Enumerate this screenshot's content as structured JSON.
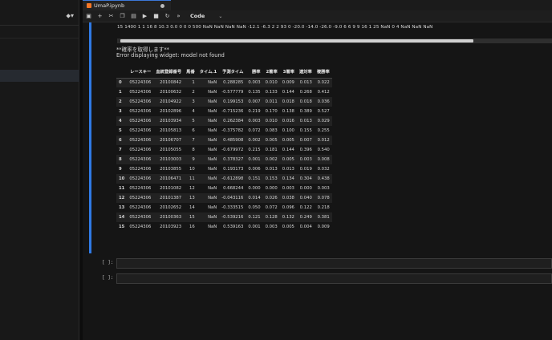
{
  "editor": {
    "tab": {
      "title": "UmaP.ipynb",
      "icon": "notebook-icon"
    },
    "toolbar": {
      "buttons": [
        "save-icon",
        "add-icon",
        "cut-icon",
        "copy-icon",
        "paste-icon",
        "run-icon",
        "stop-icon",
        "restart-icon",
        "fast-forward-icon"
      ],
      "glyphs": [
        "▣",
        "+",
        "✂",
        "❐",
        "▤",
        "▶",
        "■",
        "↻",
        "»"
      ],
      "cell_type": "Code",
      "chevron": "⌄"
    }
  },
  "sidepanel": {
    "tag_glyph": "⬥▾"
  },
  "output": {
    "topline": "15  1400   1   1   16   8   10.3   0.0   0   0   0   500   NaN   NaN   NaN   NaN   -12.1   -6.3   2   2   93   0   -20.0   -14.0   -26.0   -9.0   6   6   9   9   16   1   25   NaN   0   4   NaN   NaN   NaN",
    "message1": "**確率を取得します**",
    "message2": "Error displaying widget: model not found",
    "table": {
      "columns": [
        "",
        "レースキー",
        "血統登録番号",
        "馬番",
        "タイム.1",
        "予測タイム",
        "勝率",
        "2着率",
        "3着率",
        "連対率",
        "複勝率"
      ],
      "rows": [
        [
          "0",
          "05224306",
          "20100842",
          "1",
          "NaN",
          "0.288285",
          "0.003",
          "0.010",
          "0.009",
          "0.013",
          "0.022"
        ],
        [
          "1",
          "05224306",
          "20100632",
          "2",
          "NaN",
          "-0.577779",
          "0.135",
          "0.133",
          "0.144",
          "0.268",
          "0.412"
        ],
        [
          "2",
          "05224306",
          "20104922",
          "3",
          "NaN",
          "0.199153",
          "0.007",
          "0.011",
          "0.018",
          "0.018",
          "0.036"
        ],
        [
          "3",
          "05224306",
          "20102896",
          "4",
          "NaN",
          "-0.715236",
          "0.219",
          "0.170",
          "0.138",
          "0.389",
          "0.527"
        ],
        [
          "4",
          "05224306",
          "20103934",
          "5",
          "NaN",
          "0.262384",
          "0.003",
          "0.010",
          "0.016",
          "0.013",
          "0.029"
        ],
        [
          "5",
          "05224306",
          "20105813",
          "6",
          "NaN",
          "-0.375782",
          "0.072",
          "0.083",
          "0.100",
          "0.155",
          "0.255"
        ],
        [
          "6",
          "05224306",
          "20106707",
          "7",
          "NaN",
          "0.485908",
          "0.002",
          "0.005",
          "0.005",
          "0.007",
          "0.012"
        ],
        [
          "7",
          "05224306",
          "20105055",
          "8",
          "NaN",
          "-0.679972",
          "0.215",
          "0.181",
          "0.144",
          "0.396",
          "0.540"
        ],
        [
          "8",
          "05224306",
          "20103003",
          "9",
          "NaN",
          "0.378327",
          "0.001",
          "0.002",
          "0.005",
          "0.003",
          "0.008"
        ],
        [
          "9",
          "05224306",
          "20103855",
          "10",
          "NaN",
          "0.193173",
          "0.006",
          "0.013",
          "0.013",
          "0.019",
          "0.032"
        ],
        [
          "10",
          "05224306",
          "20106471",
          "11",
          "NaN",
          "-0.612898",
          "0.151",
          "0.153",
          "0.134",
          "0.304",
          "0.438"
        ],
        [
          "11",
          "05224306",
          "20101082",
          "12",
          "NaN",
          "0.668244",
          "0.000",
          "0.000",
          "0.003",
          "0.000",
          "0.003"
        ],
        [
          "12",
          "05224306",
          "20101387",
          "13",
          "NaN",
          "-0.043116",
          "0.014",
          "0.026",
          "0.038",
          "0.040",
          "0.078"
        ],
        [
          "13",
          "05224306",
          "20102652",
          "14",
          "NaN",
          "-0.333515",
          "0.050",
          "0.072",
          "0.096",
          "0.122",
          "0.218"
        ],
        [
          "14",
          "05224306",
          "20100363",
          "15",
          "NaN",
          "-0.539216",
          "0.121",
          "0.128",
          "0.132",
          "0.249",
          "0.381"
        ],
        [
          "15",
          "05224306",
          "20103923",
          "16",
          "NaN",
          "0.539163",
          "0.001",
          "0.003",
          "0.005",
          "0.004",
          "0.009"
        ]
      ]
    }
  },
  "empty_cells": [
    {
      "prompt": "[ ]:"
    },
    {
      "prompt": "[ ]:"
    }
  ]
}
